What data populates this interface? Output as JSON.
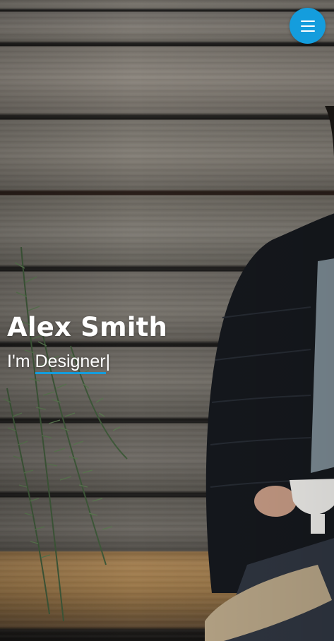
{
  "hero": {
    "name": "Alex Smith",
    "intro_prefix": "I'm",
    "role": "Designer",
    "cursor": "|"
  },
  "nav": {
    "menu_icon": "hamburger-menu-icon",
    "accent_color": "#149ddd"
  }
}
